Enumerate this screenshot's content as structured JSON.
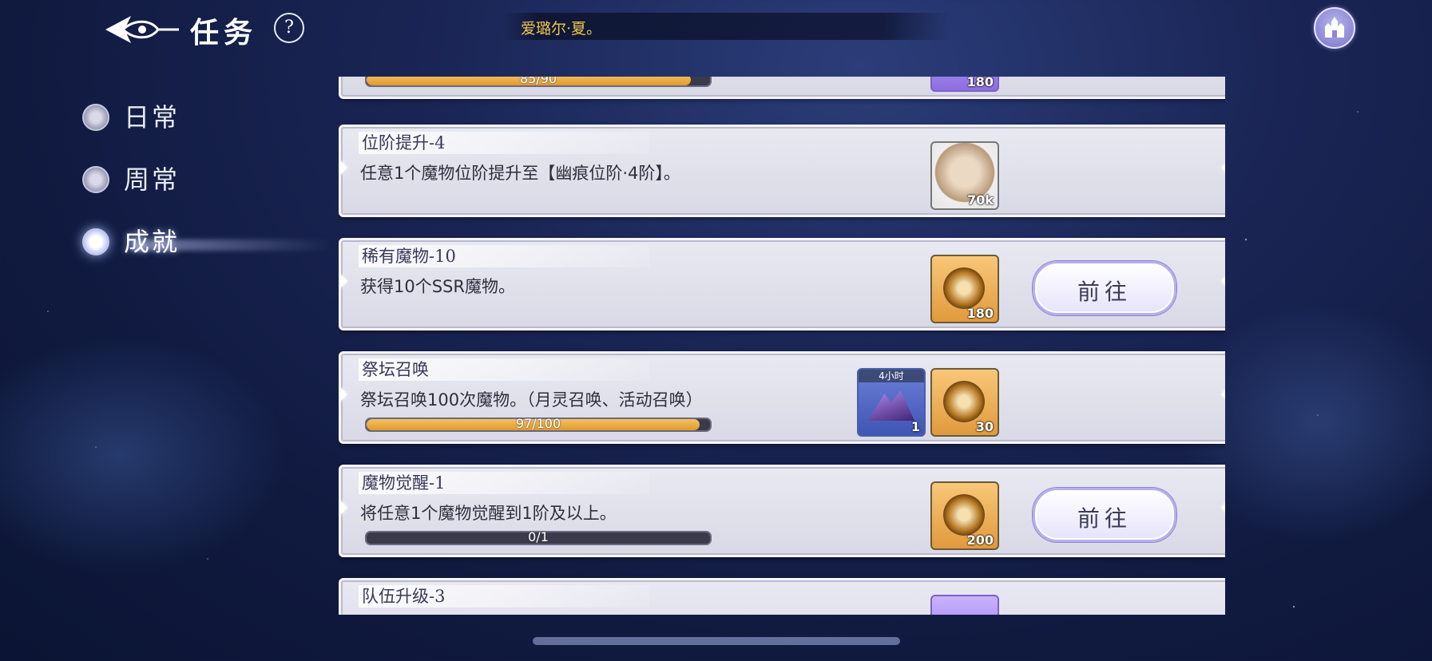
{
  "header": {
    "title": "任务",
    "help_symbol": "?",
    "marquee": "爱璐尔·夏。"
  },
  "nav": {
    "items": [
      {
        "label": "日常",
        "active": false
      },
      {
        "label": "周常",
        "active": false
      },
      {
        "label": "成就",
        "active": true
      }
    ]
  },
  "tasks": [
    {
      "name": "",
      "desc": "",
      "progress_text": "85/90",
      "progress": 0.944,
      "rewards": [
        {
          "type": "purple",
          "qty": "180"
        }
      ]
    },
    {
      "name": "位阶提升-4",
      "desc": "任意1个魔物位阶提升至【幽痕位阶·4阶】。",
      "rewards": [
        {
          "type": "coin-silver",
          "qty": "70k"
        }
      ]
    },
    {
      "name": "稀有魔物-10",
      "desc": "获得10个SSR魔物。",
      "rewards": [
        {
          "type": "coin-gold",
          "qty": "180"
        }
      ],
      "button": "前往"
    },
    {
      "name": "祭坛召唤",
      "desc": "祭坛召唤100次魔物。（月灵召唤、活动召唤）",
      "progress_text": "97/100",
      "progress": 0.97,
      "rewards": [
        {
          "type": "crystal",
          "qty": "1",
          "tag": "4小时"
        },
        {
          "type": "coin-gold",
          "qty": "30"
        }
      ]
    },
    {
      "name": "魔物觉醒-1",
      "desc": "将任意1个魔物觉醒到1阶及以上。",
      "progress_text": "0/1",
      "progress": 0.0,
      "rewards": [
        {
          "type": "coin-gold",
          "qty": "200"
        }
      ],
      "button": "前往"
    },
    {
      "name": "队伍升级-3",
      "desc": "",
      "rewards": [
        {
          "type": "purple",
          "qty": ""
        }
      ]
    }
  ],
  "colors": {
    "accent_gold": "#f1c64a",
    "progress_fill": "#e9a740",
    "panel": "#e2e2ee"
  }
}
